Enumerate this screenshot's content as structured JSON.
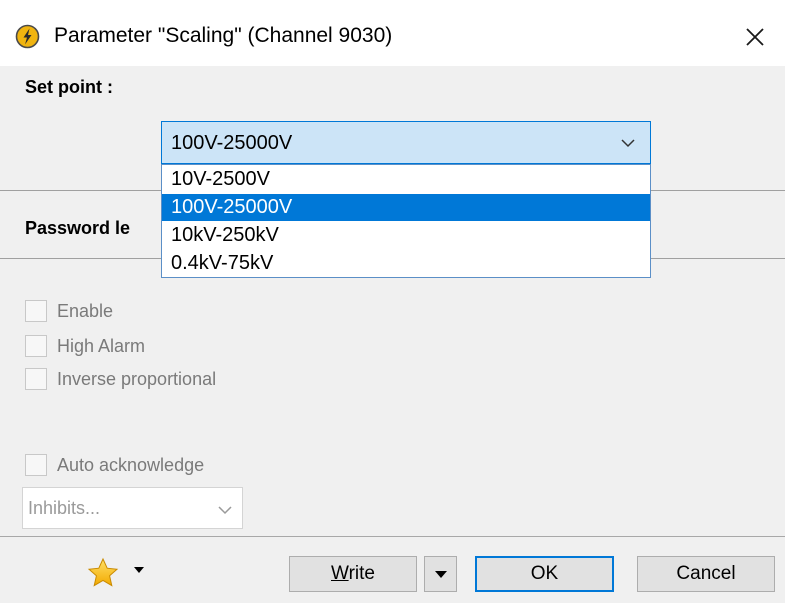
{
  "window": {
    "title": "Parameter \"Scaling\" (Channel 9030)",
    "close_label": "Close"
  },
  "set_point": {
    "label": "Set point :",
    "selected": "100V-25000V",
    "options": [
      "10V-2500V",
      "100V-25000V",
      "10kV-250kV",
      "0.4kV-75kV"
    ],
    "selected_index": 1
  },
  "password": {
    "label_visible": "Password le"
  },
  "checkboxes": {
    "enable": "Enable",
    "high_alarm": "High Alarm",
    "inverse_proportional": "Inverse proportional",
    "auto_acknowledge": "Auto acknowledge"
  },
  "inhibits": {
    "value": "Inhibits..."
  },
  "footer": {
    "write_key": "W",
    "write_rest": "rite",
    "ok": "OK",
    "cancel": "Cancel"
  },
  "colors": {
    "accent": "#0078d7",
    "combo_bg": "#cce4f7",
    "dialog_bg": "#f0f0f0",
    "disabled_text": "#7a7a7a",
    "app_icon": "#f0b410"
  },
  "icons": {
    "app": "lightning-bolt-icon",
    "close": "close-icon",
    "combo_arrow": "chevron-down-icon",
    "favorite": "star-icon",
    "favorite_menu": "caret-down-icon",
    "write_menu": "caret-down-icon"
  }
}
